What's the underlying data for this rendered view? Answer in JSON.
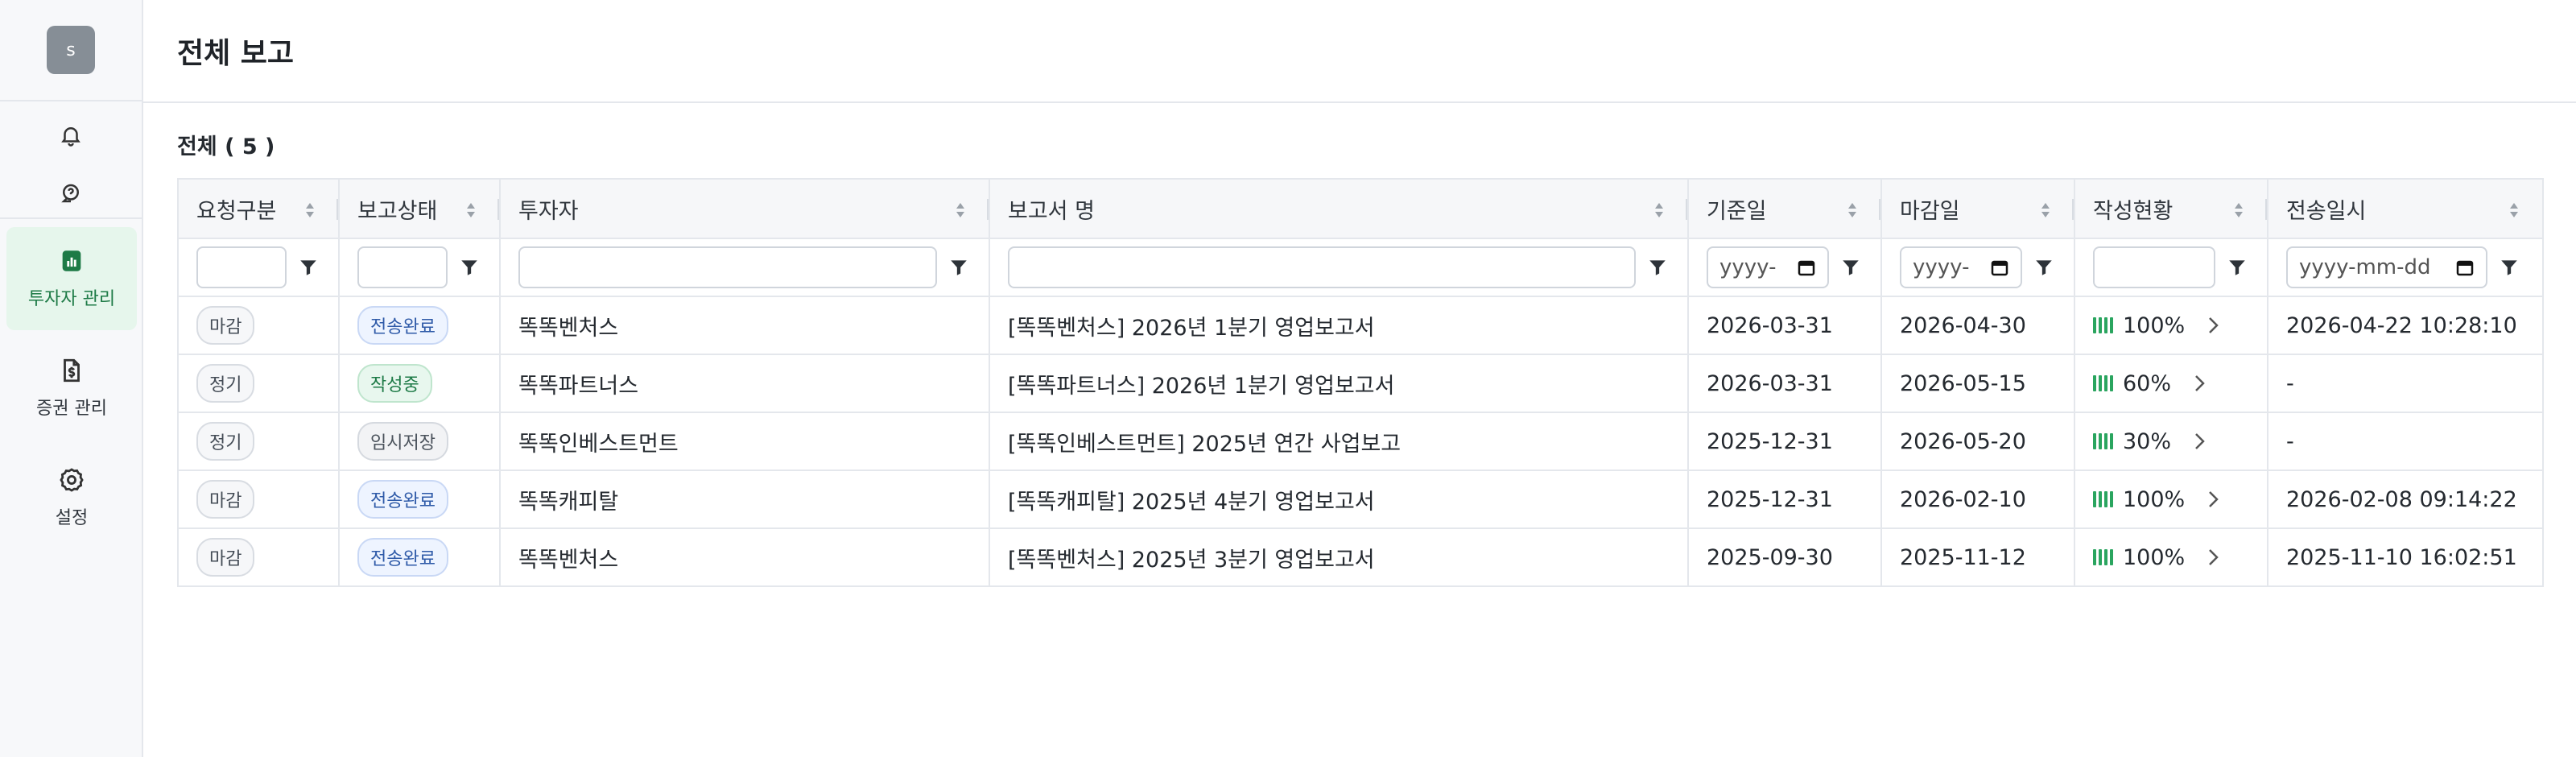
{
  "user": {
    "initial": "s"
  },
  "page": {
    "title": "전체 보고",
    "count_label": "전체 ( 5 )"
  },
  "sidebar": {
    "items": [
      {
        "label": "투자자 관리",
        "active": true
      },
      {
        "label": "증권 관리",
        "active": false
      },
      {
        "label": "설정",
        "active": false
      }
    ]
  },
  "table": {
    "columns": [
      "요청구분",
      "보고상태",
      "투자자",
      "보고서 명",
      "기준일",
      "마감일",
      "작성현황",
      "전송일시"
    ],
    "date_placeholder_short": "yyyy-",
    "date_placeholder_full": "yyyy-mm-dd",
    "rows": [
      {
        "type": "마감",
        "status": "전송완료",
        "status_kind": "sent",
        "investor": "똑똑벤처스",
        "report": "[똑똑벤처스] 2026년 1분기 영업보고서",
        "base_date": "2026-03-31",
        "deadline": "2026-04-30",
        "progress": "100%",
        "sent_at": "2026-04-22 10:28:10"
      },
      {
        "type": "정기",
        "status": "작성중",
        "status_kind": "writing",
        "investor": "똑똑파트너스",
        "report": "[똑똑파트너스] 2026년 1분기 영업보고서",
        "base_date": "2026-03-31",
        "deadline": "2026-05-15",
        "progress": "60%",
        "sent_at": "-"
      },
      {
        "type": "정기",
        "status": "임시저장",
        "status_kind": "temp",
        "investor": "똑똑인베스트먼트",
        "report": "[똑똑인베스트먼트] 2025년 연간 사업보고",
        "base_date": "2025-12-31",
        "deadline": "2026-05-20",
        "progress": "30%",
        "sent_at": "-"
      },
      {
        "type": "마감",
        "status": "전송완료",
        "status_kind": "sent",
        "investor": "똑똑캐피탈",
        "report": "[똑똑캐피탈] 2025년 4분기 영업보고서",
        "base_date": "2025-12-31",
        "deadline": "2026-02-10",
        "progress": "100%",
        "sent_at": "2026-02-08 09:14:22"
      },
      {
        "type": "마감",
        "status": "전송완료",
        "status_kind": "sent",
        "investor": "똑똑벤처스",
        "report": "[똑똑벤처스] 2025년 3분기 영업보고서",
        "base_date": "2025-09-30",
        "deadline": "2025-11-12",
        "progress": "100%",
        "sent_at": "2025-11-10 16:02:51"
      }
    ]
  },
  "colors": {
    "accent": "#2aa55f",
    "active_bg": "#e6f6ec",
    "sent_badge": "#2e5aa8"
  }
}
